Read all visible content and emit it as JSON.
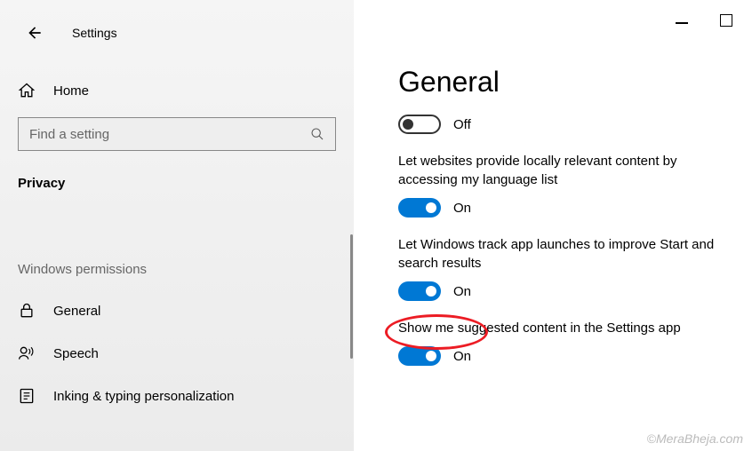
{
  "window": {
    "title": "Settings"
  },
  "sidebar": {
    "home_label": "Home",
    "search_placeholder": "Find a setting",
    "category": "Privacy",
    "section_label": "Windows permissions",
    "items": [
      {
        "label": "General",
        "icon": "lock-icon"
      },
      {
        "label": "Speech",
        "icon": "speech-icon"
      },
      {
        "label": "Inking & typing personalization",
        "icon": "inking-icon"
      }
    ]
  },
  "main": {
    "title": "General",
    "settings": [
      {
        "state": "off",
        "state_label": "Off",
        "desc": ""
      },
      {
        "state": "on",
        "state_label": "On",
        "desc": "Let websites provide locally relevant content by accessing my language list"
      },
      {
        "state": "on",
        "state_label": "On",
        "desc": "Let Windows track app launches to improve Start and search results"
      },
      {
        "state": "on",
        "state_label": "On",
        "desc": "Show me suggested content in the Settings app"
      }
    ]
  },
  "watermark": "©MeraBheja.com"
}
